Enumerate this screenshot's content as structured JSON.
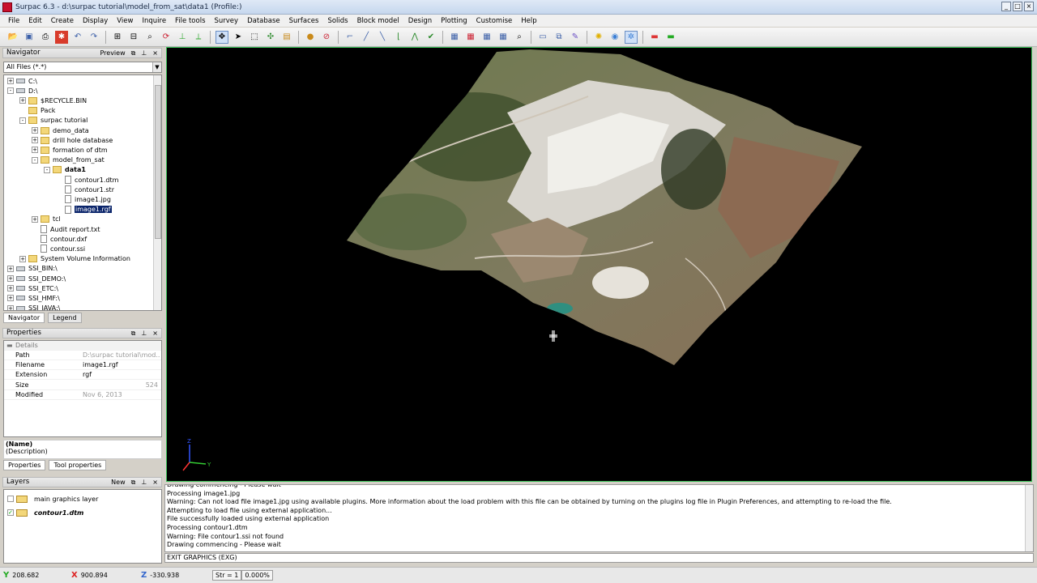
{
  "window": {
    "title": "Surpac 6.3 - d:\\surpac tutorial\\model_from_sat\\data1 (Profile:)"
  },
  "menu": [
    "File",
    "Edit",
    "Create",
    "Display",
    "View",
    "Inquire",
    "File tools",
    "Survey",
    "Database",
    "Surfaces",
    "Solids",
    "Block model",
    "Design",
    "Plotting",
    "Customise",
    "Help"
  ],
  "navigator": {
    "title": "Navigator",
    "preview_label": "Preview",
    "filter": "All Files (*.*)",
    "tree": [
      {
        "label": "C:\\",
        "indent": 0,
        "type": "drive",
        "exp": "+"
      },
      {
        "label": "D:\\",
        "indent": 0,
        "type": "drive",
        "exp": "-"
      },
      {
        "label": "$RECYCLE.BIN",
        "indent": 1,
        "type": "folder",
        "exp": "+"
      },
      {
        "label": "Pack",
        "indent": 1,
        "type": "folder",
        "exp": ""
      },
      {
        "label": "surpac tutorial",
        "indent": 1,
        "type": "folder",
        "exp": "-"
      },
      {
        "label": "demo_data",
        "indent": 2,
        "type": "folder",
        "exp": "+"
      },
      {
        "label": "drill hole database",
        "indent": 2,
        "type": "folder",
        "exp": "+"
      },
      {
        "label": "formation of dtm",
        "indent": 2,
        "type": "folder",
        "exp": "+"
      },
      {
        "label": "model_from_sat",
        "indent": 2,
        "type": "folder",
        "exp": "-"
      },
      {
        "label": "data1",
        "indent": 3,
        "type": "folder",
        "exp": "-",
        "bold": true
      },
      {
        "label": "contour1.dtm",
        "indent": 4,
        "type": "file",
        "exp": ""
      },
      {
        "label": "contour1.str",
        "indent": 4,
        "type": "file",
        "exp": ""
      },
      {
        "label": "image1.jpg",
        "indent": 4,
        "type": "file",
        "exp": ""
      },
      {
        "label": "image1.rgf",
        "indent": 4,
        "type": "file",
        "exp": "",
        "selected": true
      },
      {
        "label": "tcl",
        "indent": 2,
        "type": "folder",
        "exp": "+"
      },
      {
        "label": "Audit report.txt",
        "indent": 2,
        "type": "file",
        "exp": ""
      },
      {
        "label": "contour.dxf",
        "indent": 2,
        "type": "file",
        "exp": ""
      },
      {
        "label": "contour.ssi",
        "indent": 2,
        "type": "file",
        "exp": ""
      },
      {
        "label": "System Volume Information",
        "indent": 1,
        "type": "folder",
        "exp": "+"
      },
      {
        "label": "SSI_BIN:\\",
        "indent": 0,
        "type": "drive",
        "exp": "+"
      },
      {
        "label": "SSI_DEMO:\\",
        "indent": 0,
        "type": "drive",
        "exp": "+"
      },
      {
        "label": "SSI_ETC:\\",
        "indent": 0,
        "type": "drive",
        "exp": "+"
      },
      {
        "label": "SSI_HMF:\\",
        "indent": 0,
        "type": "drive",
        "exp": "+"
      },
      {
        "label": "SSI_JAVA:\\",
        "indent": 0,
        "type": "drive",
        "exp": "+"
      }
    ],
    "tabs": [
      "Navigator",
      "Legend"
    ]
  },
  "properties": {
    "title": "Properties",
    "section": "Details",
    "rows": [
      {
        "key": "Path",
        "value": "D:\\surpac tutorial\\mod...",
        "style": "gray"
      },
      {
        "key": "Filename",
        "value": "image1.rgf",
        "style": ""
      },
      {
        "key": "Extension",
        "value": "rgf",
        "style": ""
      },
      {
        "key": "Size",
        "value": "524",
        "style": "right"
      },
      {
        "key": "Modified",
        "value": "Nov 6, 2013",
        "style": "gray"
      }
    ],
    "name_label": "(Name)",
    "desc_label": "(Description)",
    "tabs": [
      "Properties",
      "Tool properties"
    ]
  },
  "layers": {
    "title": "Layers",
    "new_label": "New",
    "items": [
      {
        "label": "main graphics layer",
        "checked": false,
        "italic": false
      },
      {
        "label": "contour1.dtm",
        "checked": true,
        "italic": true
      }
    ]
  },
  "axes": {
    "z": "Z",
    "y": "Y"
  },
  "messages": [
    "Drawing commencing - Please wait",
    "Processing image1.jpg",
    "Warning: Can not load file image1.jpg using available plugins.  More information about the load problem with this file can be obtained by turning on the plugins log file in Plugin Preferences, and attempting to re-load the file.",
    "Attempting to load file using external application...",
    "File successfully loaded using external application",
    "Processing contour1.dtm",
    "Warning: File contour1.ssi not found",
    "Drawing commencing - Please wait"
  ],
  "command_line": "EXIT GRAPHICS (EXG)",
  "status": {
    "y_value": "208.682",
    "x_value": "900.894",
    "z_value": "-330.938",
    "str_label": "Str = 1",
    "pct": "0.000%"
  },
  "colors": {
    "viewport_border": "#3cc45a",
    "selection": "#0a246a"
  }
}
